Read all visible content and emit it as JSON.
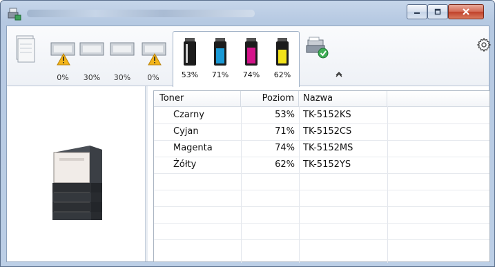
{
  "window": {
    "title_blurred": true,
    "controls": {
      "minimize": "minimize-icon",
      "maximize": "maximize-icon",
      "close": "close-icon"
    }
  },
  "toolbar": {
    "paper_trays": [
      {
        "percent": "0%",
        "warning": true
      },
      {
        "percent": "30%",
        "warning": false
      },
      {
        "percent": "30%",
        "warning": false
      },
      {
        "percent": "0%",
        "warning": true
      }
    ],
    "toners": [
      {
        "percent": "53%",
        "color": "#111111"
      },
      {
        "percent": "71%",
        "color": "#1a9ad6"
      },
      {
        "percent": "74%",
        "color": "#d4148a"
      },
      {
        "percent": "62%",
        "color": "#f2e21a"
      }
    ],
    "settings_icon": "gear-icon",
    "collapse_icon": "chevron-up-icon"
  },
  "table": {
    "columns": [
      "Toner",
      "Poziom",
      "Nazwa",
      ""
    ],
    "rows": [
      {
        "toner": "Czarny",
        "level": "53%",
        "name": "TK-5152KS"
      },
      {
        "toner": "Cyjan",
        "level": "71%",
        "name": "TK-5152CS"
      },
      {
        "toner": "Magenta",
        "level": "74%",
        "name": "TK-5152MS"
      },
      {
        "toner": "Żółty",
        "level": "62%",
        "name": "TK-5152YS"
      }
    ]
  },
  "colors": {
    "accent": "#3c7fb1",
    "warning": "#f3b51b"
  }
}
